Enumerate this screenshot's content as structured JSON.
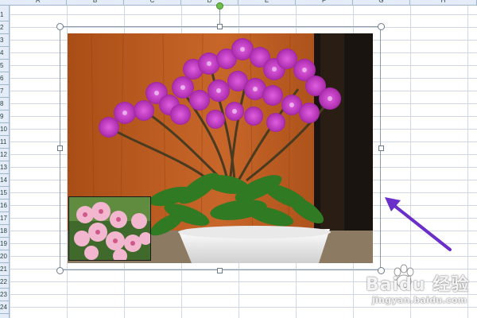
{
  "spreadsheet": {
    "columns": [
      "A",
      "B",
      "C",
      "D",
      "E",
      "F",
      "G",
      "H"
    ],
    "rows": [
      "1",
      "2",
      "3",
      "4",
      "5",
      "6",
      "7",
      "8",
      "9",
      "10",
      "11",
      "12",
      "13",
      "14",
      "15",
      "16",
      "17",
      "18",
      "19",
      "20",
      "21",
      "22",
      "23",
      "24"
    ]
  },
  "picture": {
    "subject": "potted purple orchid photo",
    "selected": true,
    "colors": {
      "wall": "#b95a1e",
      "orchid": "#a52aa7",
      "leaves": "#2f7a22",
      "pot": "#f1f1f1"
    }
  },
  "annotation": {
    "arrow_color": "#6a2ec9"
  },
  "watermark": {
    "brand": "Baidu 经验",
    "url": "jingyan.baidu.com"
  }
}
